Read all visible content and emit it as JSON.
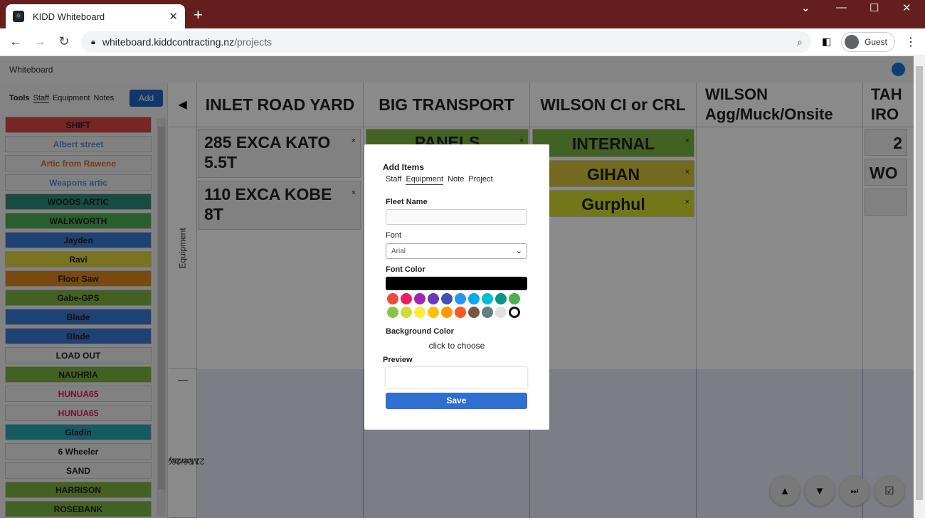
{
  "browser": {
    "tab_title": "KIDD Whiteboard",
    "tab_close": "✕",
    "new_tab": "+",
    "url_host": "whiteboard.kiddcontracting.nz",
    "url_path": "/projects",
    "profile_label": "Guest"
  },
  "app": {
    "title": "Whiteboard"
  },
  "sidebar": {
    "tabs": [
      "Tools",
      "Staff",
      "Equipment",
      "Notes"
    ],
    "add_label": "Add",
    "items": [
      {
        "label": "SHIFT",
        "bg": "#dc4646",
        "fg": "#222222"
      },
      {
        "label": "Albert street",
        "bg": "#eeeeee",
        "fg": "#4a90d9"
      },
      {
        "label": "Artic from Rawene",
        "bg": "#eeeeee",
        "fg": "#e0643c"
      },
      {
        "label": "Weapons artic",
        "bg": "#eeeeee",
        "fg": "#4a90d9"
      },
      {
        "label": "WOODS ARTIC",
        "bg": "#2e8b7a",
        "fg": "#222222"
      },
      {
        "label": "WALKWORTH",
        "bg": "#4caf50",
        "fg": "#222222"
      },
      {
        "label": "Jayden",
        "bg": "#3a7ad6",
        "fg": "#222222"
      },
      {
        "label": "Ravi",
        "bg": "#e2d43c",
        "fg": "#222222"
      },
      {
        "label": "Floor Saw",
        "bg": "#de8a1e",
        "fg": "#222222"
      },
      {
        "label": "Gabe-GPS",
        "bg": "#7cb342",
        "fg": "#222222"
      },
      {
        "label": "Blade",
        "bg": "#3a7ad6",
        "fg": "#222222"
      },
      {
        "label": "Blade",
        "bg": "#3a7ad6",
        "fg": "#222222"
      },
      {
        "label": "LOAD OUT",
        "bg": "#eeeeee",
        "fg": "#222222"
      },
      {
        "label": "NAUHRIA",
        "bg": "#7cb342",
        "fg": "#222222"
      },
      {
        "label": "HUNUA65",
        "bg": "#eeeeee",
        "fg": "#d81b60"
      },
      {
        "label": "HUNUA65",
        "bg": "#eeeeee",
        "fg": "#d81b60"
      },
      {
        "label": "Gladin",
        "bg": "#2aa6b8",
        "fg": "#222222"
      },
      {
        "label": "6 Wheeler",
        "bg": "#eeeeee",
        "fg": "#222222"
      },
      {
        "label": "SAND",
        "bg": "#eeeeee",
        "fg": "#222222"
      },
      {
        "label": "HARRISON",
        "bg": "#7cb342",
        "fg": "#222222"
      },
      {
        "label": "ROSEBANK",
        "bg": "#7cb342",
        "fg": "#222222"
      }
    ]
  },
  "board": {
    "collapse_arrow": "◀",
    "columns": [
      {
        "title": "INLET ROAD YARD"
      },
      {
        "title": "BIG TRANSPORT"
      },
      {
        "title": "WILSON CI or CRL"
      },
      {
        "title": "WILSON Agg/Muck/Onsite"
      },
      {
        "title": "TAH IRO"
      }
    ],
    "row_equipment": "Equipment",
    "row_collapse": "—",
    "row_day": "Monday",
    "row_date": "22/08/2022",
    "cards": {
      "inlet_1": "285 EXCA KATO 5.5T",
      "inlet_2": "110 EXCA KOBE 8T",
      "big_1": "PANELS",
      "wilson_1": "INTERNAL",
      "wilson_2": "GIHAN",
      "wilson_3": "Gurphul",
      "tah_1": "2",
      "tah_2": "WO",
      "close": "×"
    },
    "colors": {
      "green": "#7cb342",
      "yellow_dark": "#d4c23a",
      "yellow": "#d6dc2c"
    }
  },
  "modal": {
    "title": "Add Items",
    "tabs": [
      "Staff",
      "Equipment",
      "Note",
      "Project"
    ],
    "fleet_name_label": "Fleet Name",
    "font_label": "Font",
    "font_value": "Arial",
    "font_color_label": "Font Color",
    "palette": [
      "#e74c3c",
      "#e91e63",
      "#9c27b0",
      "#673ab7",
      "#3f51b5",
      "#2196f3",
      "#03a9f4",
      "#00bcd4",
      "#009688",
      "#4caf50",
      "#8bc34a",
      "#cddc39",
      "#ffeb3b",
      "#ffc107",
      "#ff9800",
      "#ff5722",
      "#795548",
      "#607d8b",
      "#e0e0e0",
      "#ffffff"
    ],
    "bg_color_label": "Background Color",
    "bg_choose_text": "click to choose",
    "preview_label": "Preview",
    "save_label": "Save"
  }
}
